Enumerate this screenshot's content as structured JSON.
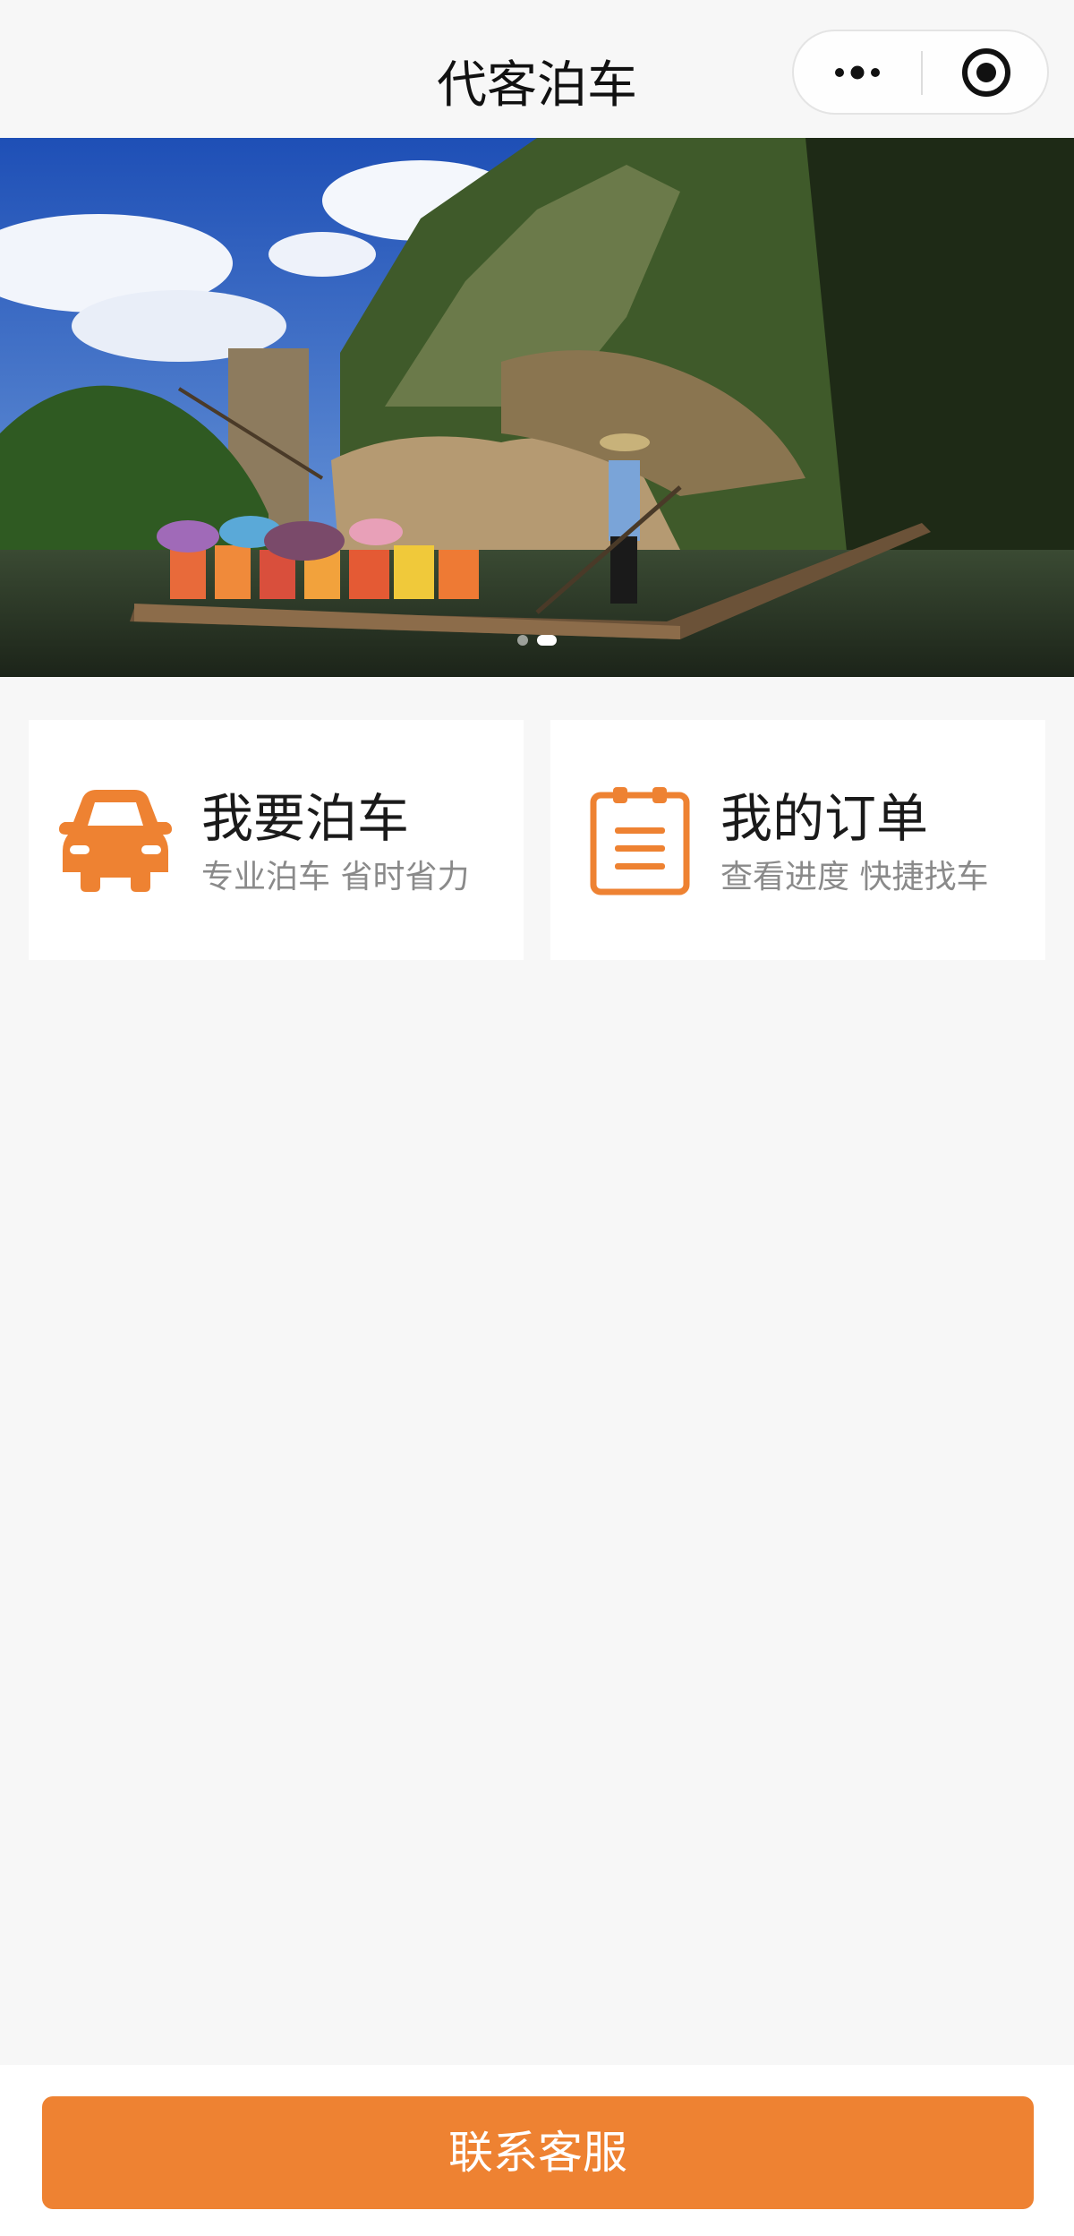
{
  "nav": {
    "title": "代客泊车"
  },
  "banner": {
    "slide_count": 2,
    "active_index": 1
  },
  "cards": [
    {
      "title": "我要泊车",
      "subtitle": "专业泊车 省时省力",
      "icon": "car-icon"
    },
    {
      "title": "我的订单",
      "subtitle": "查看进度 快捷找车",
      "icon": "clipboard-icon"
    }
  ],
  "footer": {
    "button_label": "联系客服"
  },
  "colors": {
    "accent": "#ee8232",
    "background": "#f7f7f7"
  }
}
